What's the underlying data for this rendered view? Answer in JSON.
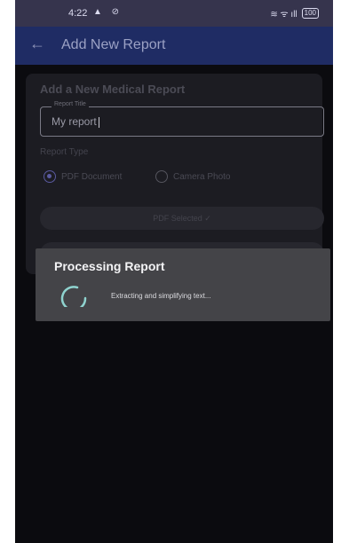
{
  "status_bar": {
    "time": "4:22",
    "left_icons": "▲ ⊘",
    "signal_icons": "≋ ᯤ ıll",
    "battery": "100"
  },
  "app_bar": {
    "title": "Add New Report",
    "back_icon": "arrow-left-icon"
  },
  "form": {
    "card_title": "Add a New Medical Report",
    "report_title_label": "Report Title",
    "report_title_value": "My report",
    "report_type_label": "Report Type",
    "options": [
      {
        "label": "PDF Document",
        "selected": true
      },
      {
        "label": "Camera Photo",
        "selected": false
      }
    ],
    "pdf_button_label": "PDF Selected ✓"
  },
  "dialog": {
    "title": "Processing Report",
    "message": "Extracting and simplifying text...",
    "spinner_color": "#8fd3cf"
  }
}
